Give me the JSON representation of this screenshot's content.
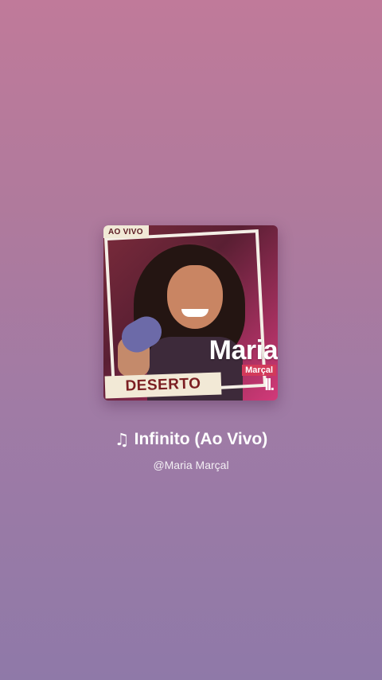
{
  "cover": {
    "badge": "AO VIVO",
    "artist_name": "Maria",
    "artist_surname": "Marçal",
    "logo_mark": "ll.",
    "album_title": "DESERTO"
  },
  "song": {
    "icon": "music-note-icon",
    "title": "Infinito (Ao Vivo)"
  },
  "artist_handle": "@Maria Marçal",
  "colors": {
    "background_top": "#c07a9a",
    "background_bottom": "#8f79a8",
    "accent": "#d23a5a"
  }
}
